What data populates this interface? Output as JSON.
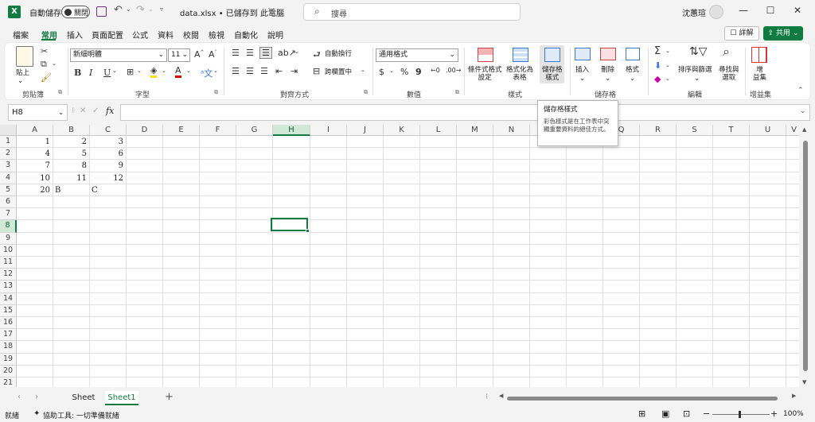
{
  "titlebar": {
    "autosave_label": "自動儲存",
    "autosave_state": "關閉",
    "file_title": "data.xlsx • 已儲存到 此電腦",
    "title_chevron": "⌵",
    "search_placeholder": "搜尋",
    "user_name": "沈蕙瑄",
    "minimize": "—",
    "maximize": "☐",
    "close": "✕"
  },
  "menu": {
    "tabs": [
      "檔案",
      "常用",
      "插入",
      "頁面配置",
      "公式",
      "資料",
      "校閱",
      "檢視",
      "自動化",
      "說明"
    ],
    "active_index": 1,
    "comment_label": "詳解",
    "share_label": "共用"
  },
  "ribbon": {
    "clipboard": {
      "paste": "貼上",
      "group": "剪貼簿"
    },
    "font": {
      "name": "新細明體",
      "size": "11",
      "grow": "A^",
      "shrink": "A˅",
      "bold": "B",
      "italic": "I",
      "underline": "U",
      "group": "字型"
    },
    "alignment": {
      "wrap": "自動換行",
      "merge": "跨欄置中",
      "group": "對齊方式"
    },
    "number": {
      "format": "通用格式",
      "currency": "$",
      "percent": "%",
      "comma": "9",
      "group": "數值"
    },
    "styles": {
      "conditional": "條件式格式\n設定",
      "table": "格式化為\n表格",
      "cellstyles": "儲存格\n樣式",
      "group": "樣式"
    },
    "cells": {
      "insert": "插入",
      "delete": "刪除",
      "format": "格式",
      "group": "儲存格"
    },
    "editing": {
      "sum": "Σ",
      "sort": "排序與篩選",
      "find": "尋找與\n選取",
      "group": "編輯"
    },
    "addins": {
      "label": "增\n益集",
      "group": "增益集"
    }
  },
  "formula_bar": {
    "name_box": "H8",
    "fx": "fx",
    "cancel": "✕",
    "enter": "✓",
    "value": ""
  },
  "grid": {
    "columns": [
      "A",
      "B",
      "C",
      "D",
      "E",
      "F",
      "G",
      "H",
      "I",
      "J",
      "K",
      "L",
      "M",
      "N",
      "O",
      "P",
      "Q",
      "R",
      "S",
      "T",
      "U",
      "V"
    ],
    "selected_column": "H",
    "rows": [
      "1",
      "2",
      "3",
      "4",
      "5",
      "6",
      "7",
      "8",
      "9",
      "10",
      "11",
      "12",
      "13",
      "14",
      "15",
      "16",
      "17",
      "18",
      "19",
      "20",
      "21"
    ],
    "selected_row": "8",
    "cells": [
      {
        "r": 0,
        "c": 0,
        "v": "1",
        "t": "num"
      },
      {
        "r": 0,
        "c": 1,
        "v": "2",
        "t": "num"
      },
      {
        "r": 0,
        "c": 2,
        "v": "3",
        "t": "num"
      },
      {
        "r": 1,
        "c": 0,
        "v": "4",
        "t": "num"
      },
      {
        "r": 1,
        "c": 1,
        "v": "5",
        "t": "num"
      },
      {
        "r": 1,
        "c": 2,
        "v": "6",
        "t": "num"
      },
      {
        "r": 2,
        "c": 0,
        "v": "7",
        "t": "num"
      },
      {
        "r": 2,
        "c": 1,
        "v": "8",
        "t": "num"
      },
      {
        "r": 2,
        "c": 2,
        "v": "9",
        "t": "num"
      },
      {
        "r": 3,
        "c": 0,
        "v": "10",
        "t": "num"
      },
      {
        "r": 3,
        "c": 1,
        "v": "11",
        "t": "num"
      },
      {
        "r": 3,
        "c": 2,
        "v": "12",
        "t": "num"
      },
      {
        "r": 4,
        "c": 0,
        "v": "20",
        "t": "num"
      },
      {
        "r": 4,
        "c": 1,
        "v": "B",
        "t": "txt"
      },
      {
        "r": 4,
        "c": 2,
        "v": "C",
        "t": "txt"
      }
    ]
  },
  "tooltip": {
    "title": "儲存格樣式",
    "body": "彩色樣式是在工作表中突顯重要資料的絕佳方式。"
  },
  "sheets": {
    "tabs": [
      "Sheet",
      "Sheet1"
    ],
    "active_index": 1,
    "add": "+"
  },
  "status": {
    "ready": "就緒",
    "accessibility": "協助工具: 一切準備就緒",
    "zoom": "100%"
  }
}
